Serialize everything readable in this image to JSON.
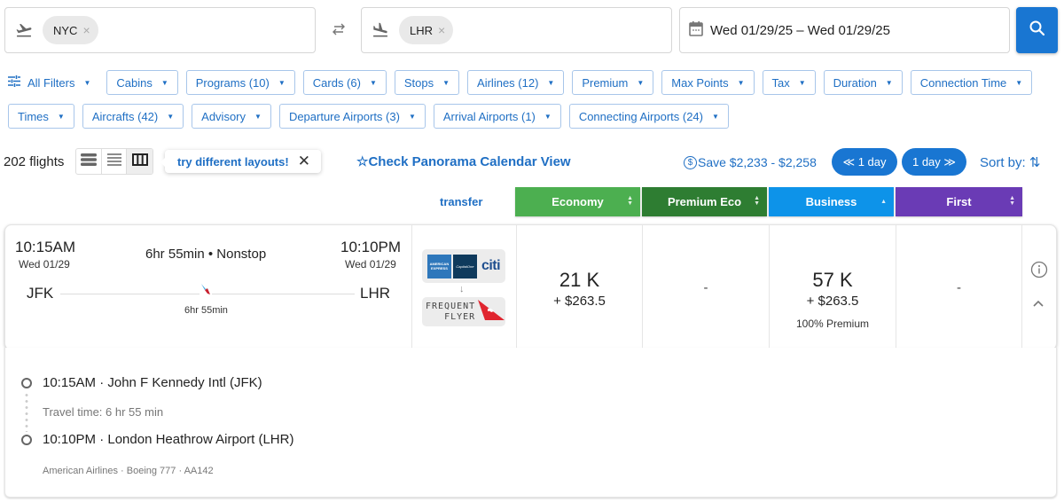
{
  "search": {
    "origin": "NYC",
    "destination": "LHR",
    "dates": "Wed 01/29/25 – Wed 01/29/25",
    "chip_remove": "×",
    "swap_glyph": "⇄"
  },
  "filters": {
    "all_filters": "All Filters",
    "row1": [
      "Cabins",
      "Programs (10)",
      "Cards (6)",
      "Stops",
      "Airlines (12)",
      "Premium",
      "Max Points",
      "Tax",
      "Duration",
      "Connection Time"
    ],
    "row2": [
      "Times",
      "Aircrafts (42)",
      "Advisory",
      "Departure Airports (3)",
      "Arrival Airports (1)",
      "Connecting Airports (24)"
    ]
  },
  "toolbar": {
    "flight_count": "202 flights",
    "layout_tip": "try different layouts!",
    "tip_close": "✕",
    "panorama": "☆Check Panorama Calendar View",
    "save": "Save $2,233 - $2,258",
    "dollar_glyph": "$",
    "prev_day": "≪ 1 day",
    "next_day": "1 day ≫",
    "sort_by": "Sort by: ⇅"
  },
  "columns": {
    "transfer": "transfer",
    "cabins": [
      {
        "label": "Economy",
        "color": "#4caf50"
      },
      {
        "label": "Premium Eco",
        "color": "#2e7d32"
      },
      {
        "label": "Business",
        "color": "#0d93e9"
      },
      {
        "label": "First",
        "color": "#6a3bb5"
      }
    ]
  },
  "flight": {
    "dep_time": "10:15AM",
    "dep_date": "Wed 01/29",
    "arr_time": "10:10PM",
    "arr_date": "Wed 01/29",
    "summary": "6hr 55min • Nonstop",
    "dep_airport": "JFK",
    "arr_airport": "LHR",
    "duration": "6hr 55min",
    "transfer": {
      "cards": [
        "American Express",
        "Capital One",
        "citi"
      ],
      "arrow": "↓",
      "program_line1": "FREQUENT",
      "program_line2": "FLYER",
      "program": "Qantas Frequent Flyer"
    },
    "prices": {
      "economy": {
        "points": "21 K",
        "tax": "+ $263.5"
      },
      "premium_economy": {
        "value": "-"
      },
      "business": {
        "points": "57 K",
        "tax": "+ $263.5",
        "note": "100% Premium"
      },
      "first": {
        "value": "-"
      }
    }
  },
  "details": {
    "dep_line": "10:15AM · John F Kennedy Intl (JFK)",
    "travel_time": "Travel time: 6 hr 55 min",
    "arr_line": "10:10PM · London Heathrow Airport (LHR)",
    "meta": "American Airlines · Boeing 777 · AA142"
  },
  "colors": {
    "accent": "#1976d2",
    "link": "#1f6fc4"
  }
}
